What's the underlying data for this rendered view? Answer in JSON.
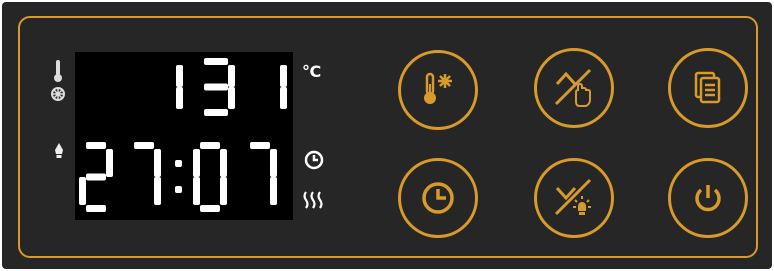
{
  "display": {
    "temperature": "131",
    "time_hours": "27",
    "time_minutes": "07",
    "temperature_unit": "°C"
  },
  "indicators": {
    "left": [
      "thermometer-fan-icon",
      "light-bulb-icon"
    ],
    "right": [
      "clock-icon",
      "heat-waves-icon"
    ]
  },
  "buttons": [
    {
      "name": "temp-fan-button",
      "icon": "thermometer-snowflake-icon"
    },
    {
      "name": "up-button",
      "icon": "up-hand-icon"
    },
    {
      "name": "programs-button",
      "icon": "document-stack-icon"
    },
    {
      "name": "timer-button",
      "icon": "clock-icon"
    },
    {
      "name": "down-light-button",
      "icon": "down-light-icon"
    },
    {
      "name": "power-button",
      "icon": "power-icon"
    }
  ],
  "colors": {
    "accent": "#d79a2b",
    "panel": "#262626",
    "display_bg": "#000000",
    "digits": "#ffffff"
  }
}
